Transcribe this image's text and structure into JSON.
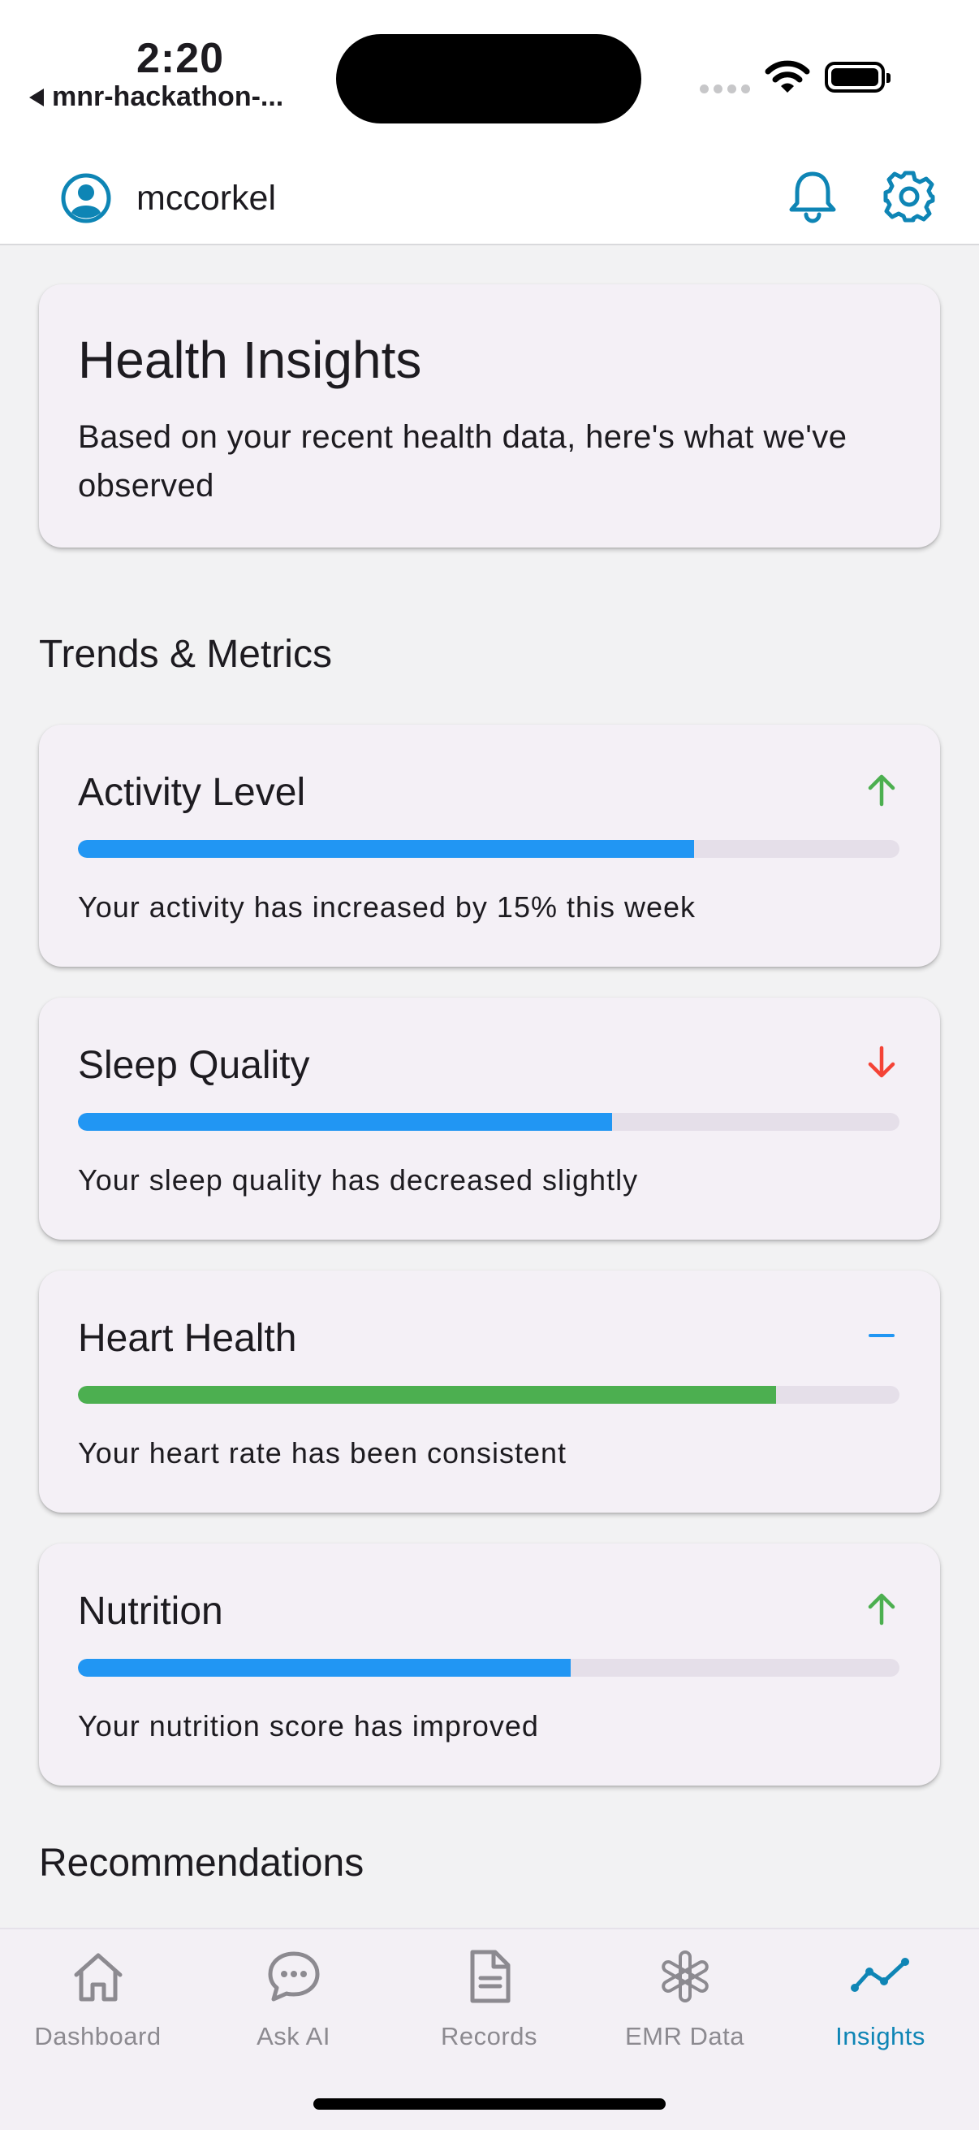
{
  "status_bar": {
    "time": "2:20",
    "back_app": "mnr-hackathon-..."
  },
  "header": {
    "username": "mccorkel"
  },
  "insights_card": {
    "title": "Health Insights",
    "description": "Based on your recent health data, here's what we've observed"
  },
  "trends": {
    "title": "Trends & Metrics",
    "metrics": [
      {
        "title": "Activity Level",
        "description": "Your activity has increased by 15% this week",
        "progress": 0.75,
        "bar_color": "#2196f3",
        "trend": "up",
        "trend_color": "#4caf50"
      },
      {
        "title": "Sleep Quality",
        "description": "Your sleep quality has decreased slightly",
        "progress": 0.65,
        "bar_color": "#2196f3",
        "trend": "down",
        "trend_color": "#f44336"
      },
      {
        "title": "Heart Health",
        "description": "Your heart rate has been consistent",
        "progress": 0.85,
        "bar_color": "#4caf50",
        "trend": "stable",
        "trend_color": "#2196f3"
      },
      {
        "title": "Nutrition",
        "description": "Your nutrition score has improved",
        "progress": 0.6,
        "bar_color": "#2196f3",
        "trend": "up",
        "trend_color": "#4caf50"
      }
    ]
  },
  "recommendations": {
    "title": "Recommendations"
  },
  "nav": {
    "items": [
      {
        "label": "Dashboard",
        "icon": "home-icon"
      },
      {
        "label": "Ask AI",
        "icon": "chat-icon"
      },
      {
        "label": "Records",
        "icon": "document-icon"
      },
      {
        "label": "EMR Data",
        "icon": "medical-icon"
      },
      {
        "label": "Insights",
        "icon": "trend-icon",
        "active": true
      }
    ]
  },
  "colors": {
    "accent": "#0e85b5",
    "card_bg": "#f4f0f6",
    "page_bg": "#f2f2f3"
  }
}
